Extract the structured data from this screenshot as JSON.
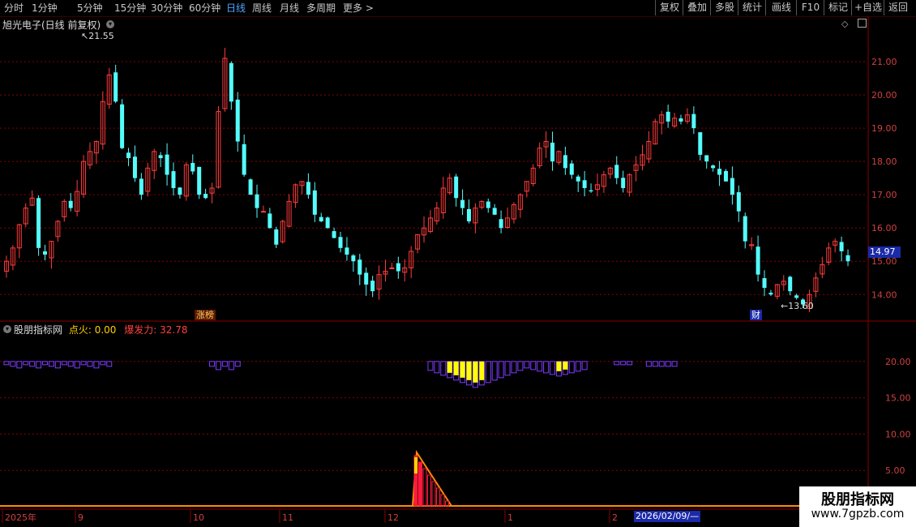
{
  "toolbar": {
    "periods": [
      "分时",
      "1分钟",
      "5分钟",
      "15分钟",
      "30分钟",
      "60分钟",
      "日线",
      "周线",
      "月线",
      "多周期",
      "更多 >"
    ],
    "active_period": "日线",
    "buttons": [
      "复权",
      "叠加",
      "多股",
      "统计",
      "画线",
      "F10",
      "标记",
      "+自选",
      "返回"
    ]
  },
  "chart": {
    "title": "旭光电子(日线 前复权)",
    "high_label": "21.55",
    "low_label": "13.60",
    "last_price": "14.97",
    "badge_zt": "涨榜",
    "badge_cai": "财"
  },
  "indicator": {
    "name": "股朋指标网",
    "field1_label": "点火:",
    "field1_value": "0.00",
    "field2_label": "爆发力:",
    "field2_value": "32.78"
  },
  "date_axis": {
    "labels": [
      "2025年",
      "9",
      "10",
      "11",
      "12",
      "1",
      "2"
    ],
    "selected": "2026/02/09/—"
  },
  "watermark": {
    "line1": "股朋指标网",
    "line2": "www.7gpzb.com"
  },
  "colors": {
    "up": "#ff3c3c",
    "down": "#54fcfc",
    "grid": "#8b0000",
    "indicator_purple": "#7b3cff",
    "indicator_yellow": "#ffff00"
  },
  "chart_data": [
    {
      "type": "candlestick",
      "title": "旭光电子(日线 前复权)",
      "y_ticks": [
        21.0,
        20.0,
        19.0,
        18.0,
        17.0,
        16.0,
        15.0,
        14.0
      ],
      "ylim": [
        13.3,
        22.0
      ],
      "x_labels": [
        "2025年",
        "9",
        "10",
        "11",
        "12",
        "1",
        "2"
      ],
      "close_series_approx": [
        15.0,
        15.4,
        16.1,
        16.6,
        16.9,
        15.4,
        15.2,
        15.6,
        16.2,
        16.8,
        16.6,
        17.1,
        18.0,
        18.3,
        18.6,
        19.8,
        20.6,
        19.8,
        18.4,
        18.1,
        17.5,
        17.0,
        17.8,
        18.3,
        18.1,
        17.6,
        17.2,
        17.0,
        17.9,
        17.7,
        17.0,
        16.9,
        17.2,
        19.5,
        21.1,
        19.8,
        18.6,
        17.6,
        17.0,
        16.6,
        16.5,
        16.0,
        15.5,
        16.2,
        16.8,
        17.3,
        17.4,
        17.0,
        16.4,
        16.2,
        16.0,
        15.7,
        15.4,
        15.2,
        15.0,
        14.6,
        14.3,
        14.1,
        14.6,
        14.7,
        14.8,
        14.7,
        14.8,
        15.3,
        15.8,
        16.0,
        16.3,
        16.6,
        17.2,
        17.5,
        16.9,
        16.6,
        16.2,
        16.6,
        16.8,
        16.6,
        16.4,
        16.0,
        16.3,
        16.7,
        17.0,
        17.4,
        17.8,
        18.4,
        18.6,
        18.0,
        18.3,
        17.8,
        17.6,
        17.4,
        17.2,
        17.1,
        17.3,
        17.6,
        17.8,
        17.5,
        17.2,
        17.6,
        17.9,
        18.2,
        18.6,
        19.2,
        19.4,
        19.2,
        19.3,
        19.2,
        19.4,
        19.0,
        18.2,
        18.0,
        17.8,
        17.6,
        17.4,
        17.0,
        16.5,
        15.6,
        15.5,
        14.6,
        14.2,
        14.0,
        14.3,
        14.4,
        14.1,
        13.9,
        13.7,
        14.0,
        14.5,
        14.9,
        15.4,
        15.6,
        15.3,
        15.0
      ]
    },
    {
      "type": "bar",
      "title": "股朋指标网",
      "y_ticks": [
        20.0,
        15.0,
        10.0,
        5.0
      ],
      "ylim": [
        0,
        24
      ],
      "series": [
        {
          "name": "点火",
          "last_value": 0.0
        },
        {
          "name": "爆发力",
          "last_value": 32.78
        }
      ]
    }
  ]
}
